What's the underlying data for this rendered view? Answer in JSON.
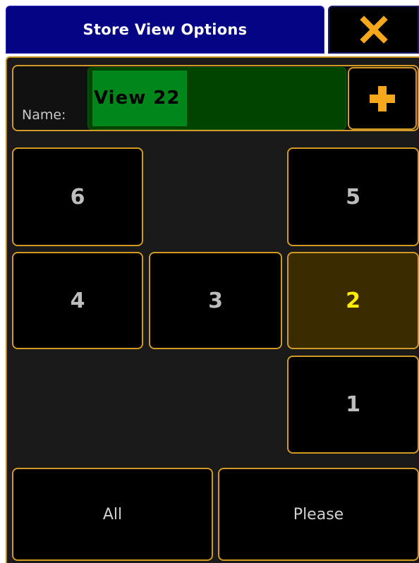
{
  "dialog": {
    "title": "Store View Options",
    "close_icon": "close-icon",
    "close_color": "#f5a81c"
  },
  "name": {
    "label": "Name:",
    "value": "View 22",
    "add_icon": "plus-icon"
  },
  "slots": [
    {
      "label": "6",
      "active": false
    },
    {
      "label": "5",
      "active": false
    },
    {
      "label": "4",
      "active": false
    },
    {
      "label": "3",
      "active": false
    },
    {
      "label": "2",
      "active": true
    },
    {
      "label": "1",
      "active": false
    }
  ],
  "buttons": {
    "all": "All",
    "please": "Please"
  },
  "colors": {
    "title_bg": "#040484",
    "accent_border": "#d19a25",
    "name_field_bg": "#004400",
    "selection_bg": "#00861a",
    "active_slot_bg": "#3b2c00",
    "active_slot_text": "#ffee00"
  }
}
